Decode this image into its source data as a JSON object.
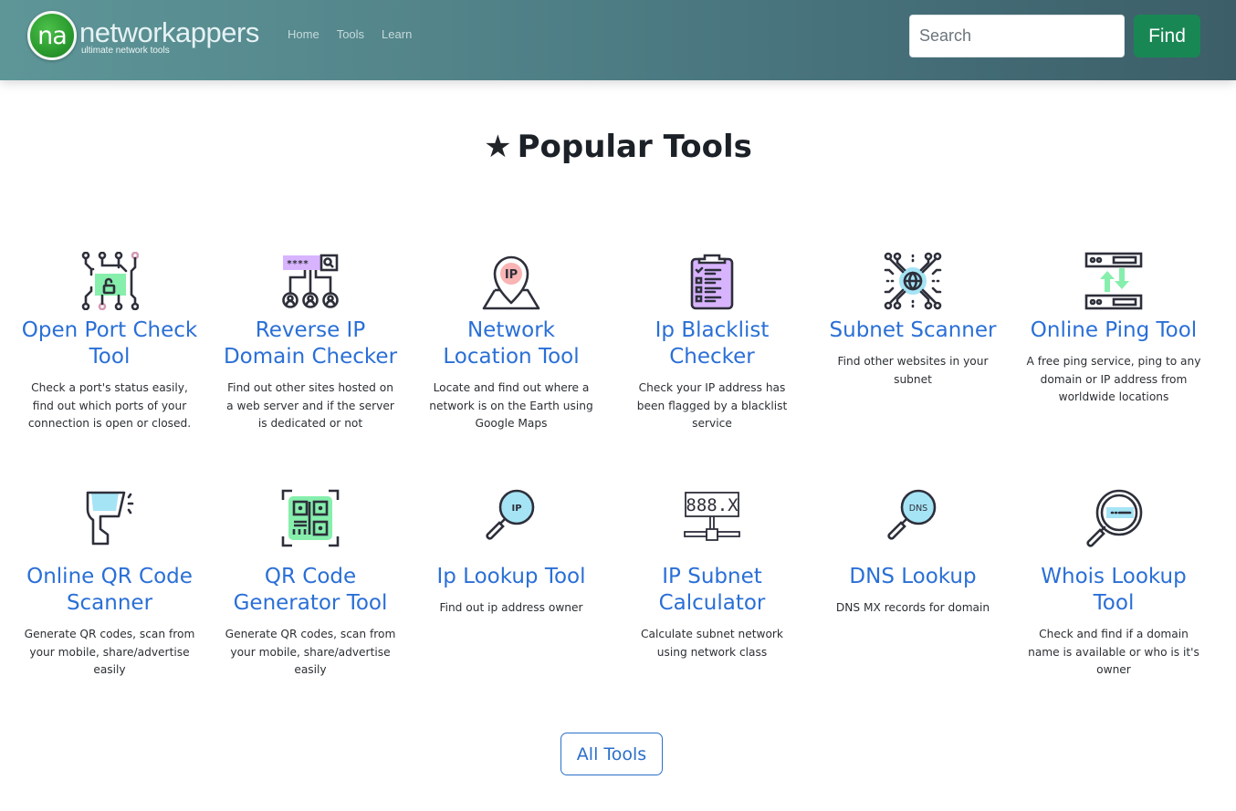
{
  "header": {
    "logo_badge": "na",
    "logo_name": "networkappers",
    "logo_tagline": "ultimate network tools",
    "nav": [
      "Home",
      "Tools",
      "Learn"
    ],
    "search_placeholder": "Search",
    "find_label": "Find"
  },
  "main": {
    "title": "Popular Tools",
    "title_icon": "star-icon",
    "tools": [
      {
        "title": "Open Port Check Tool",
        "desc": "Check a port's status easily, find out which ports of your connection is open or closed.",
        "icon": "circuit-lock-icon"
      },
      {
        "title": "Reverse IP Domain Checker",
        "desc": "Find out other sites hosted on a web server and if the server is dedicated or not",
        "icon": "network-users-icon"
      },
      {
        "title": "Network Location Tool",
        "desc": "Locate and find out where a network is on the Earth using Google Maps",
        "icon": "ip-map-pin-icon"
      },
      {
        "title": "Ip Blacklist Checker",
        "desc": "Check your IP address has been flagged by a blacklist service",
        "icon": "clipboard-checklist-icon"
      },
      {
        "title": "Subnet Scanner",
        "desc": "Find other websites in your subnet",
        "icon": "globe-circuit-icon"
      },
      {
        "title": "Online Ping Tool",
        "desc": "A free ping service, ping to any domain or IP address from worldwide locations",
        "icon": "servers-ping-icon"
      },
      {
        "title": "Online QR Code Scanner",
        "desc": "Generate QR codes, scan from your mobile, share/advertise easily",
        "icon": "barcode-scanner-icon"
      },
      {
        "title": "QR Code Generator Tool",
        "desc": "Generate QR codes, scan from your mobile, share/advertise easily",
        "icon": "qr-code-icon"
      },
      {
        "title": "Ip Lookup Tool",
        "desc": "Find out ip address owner",
        "icon": "ip-magnifier-icon"
      },
      {
        "title": "IP Subnet Calculator",
        "desc": "Calculate subnet network using network class",
        "icon": "subnet-display-icon"
      },
      {
        "title": "DNS Lookup",
        "desc": "DNS MX records for domain",
        "icon": "dns-magnifier-icon"
      },
      {
        "title": "Whois Lookup Tool",
        "desc": "Check and find if a domain name is available or who is it's owner",
        "icon": "whois-magnifier-icon"
      }
    ],
    "icon_labels": {
      "ip": "IP",
      "dns": "DNS",
      "subnet": "888.X",
      "mask": "****"
    },
    "all_tools_label": "All Tools"
  },
  "colors": {
    "link_blue": "#2a6fd6",
    "find_green": "#198754",
    "accent_mint": "#86efac",
    "accent_lavender": "#d8b4fe",
    "accent_sky": "#a5e4f5",
    "accent_pink": "#f9b4b4"
  }
}
